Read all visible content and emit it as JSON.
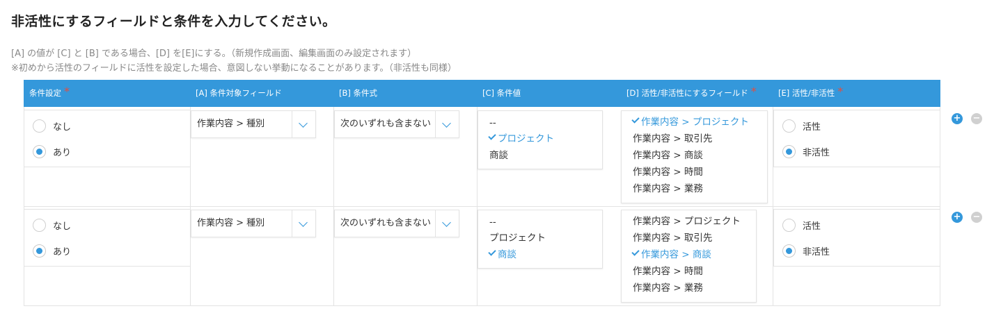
{
  "page": {
    "title": "非活性にするフィールドと条件を入力してください。",
    "description1": "[A] の値が [C] と [B] である場合、[D] を[E]にする。（新規作成画面、編集画面のみ設定されます）",
    "description2": "※初めから活性のフィールドに活性を設定した場合、意図しない挙動になることがあります。（非活性も同様）"
  },
  "table": {
    "headers": [
      {
        "label": "条件設定",
        "required": "*"
      },
      {
        "label": "[A] 条件対象フィールド"
      },
      {
        "label": "[B] 条件式"
      },
      {
        "label": "[C] 条件値"
      },
      {
        "label": "[D] 活性/非活性にするフィールド",
        "required": "*"
      },
      {
        "label": "[E] 活性/非活性",
        "required": "*"
      }
    ],
    "rows": [
      {
        "condition": {
          "options": [
            "なし",
            "あり"
          ],
          "selected": "あり"
        },
        "field": "作業内容 > 種別",
        "operator": "次のいずれも含まない",
        "values": [
          {
            "label": "--",
            "selected": false
          },
          {
            "label": "プロジェクト",
            "selected": true
          },
          {
            "label": "商談",
            "selected": false
          }
        ],
        "targets": [
          {
            "label": "作業内容 > プロジェクト",
            "selected": true
          },
          {
            "label": "作業内容 > 取引先",
            "selected": false
          },
          {
            "label": "作業内容 > 商談",
            "selected": false
          },
          {
            "label": "作業内容 > 時間",
            "selected": false
          },
          {
            "label": "作業内容 > 業務",
            "selected": false
          }
        ],
        "state": {
          "options": [
            "活性",
            "非活性"
          ],
          "selected": "非活性"
        }
      },
      {
        "condition": {
          "options": [
            "なし",
            "あり"
          ],
          "selected": "あり"
        },
        "field": "作業内容 > 種別",
        "operator": "次のいずれも含まない",
        "values": [
          {
            "label": "--",
            "selected": false
          },
          {
            "label": "プロジェクト",
            "selected": false
          },
          {
            "label": "商談",
            "selected": true
          }
        ],
        "targets": [
          {
            "label": "作業内容 > プロジェクト",
            "selected": false
          },
          {
            "label": "作業内容 > 取引先",
            "selected": false
          },
          {
            "label": "作業内容 > 商談",
            "selected": true
          },
          {
            "label": "作業内容 > 時間",
            "selected": false
          },
          {
            "label": "作業内容 > 業務",
            "selected": false
          }
        ],
        "state": {
          "options": [
            "活性",
            "非活性"
          ],
          "selected": "非活性"
        }
      }
    ],
    "row_actions": {
      "add_label": "+",
      "remove_label": "−"
    }
  },
  "colors": {
    "accent": "#3498db",
    "required": "#e74c3c",
    "remove": "#d0d0d0"
  },
  "icons": {
    "select_toggle": "chevron-down-icon",
    "selected_item": "check-icon",
    "add": "plus-icon",
    "remove": "minus-icon"
  }
}
